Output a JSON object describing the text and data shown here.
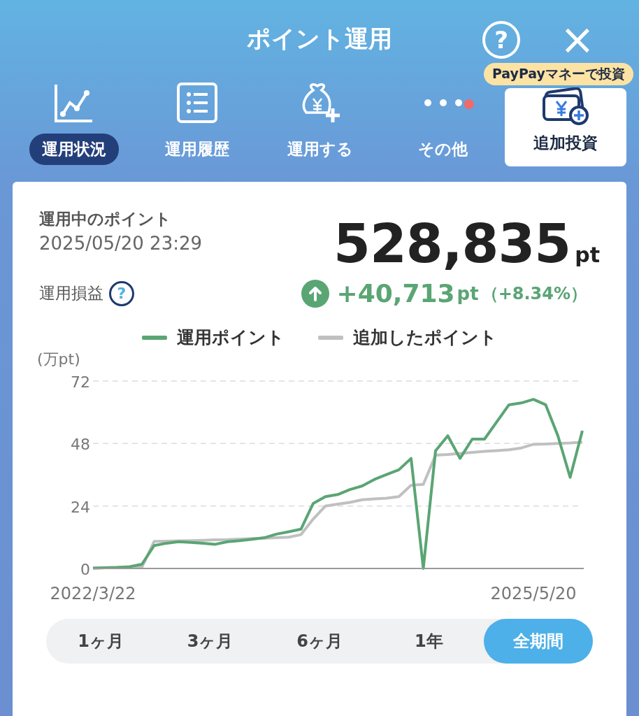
{
  "header": {
    "title": "ポイント運用",
    "help_icon": "?",
    "close_icon": "×"
  },
  "tabs": [
    {
      "label": "運用状況",
      "selected": true,
      "kind": "normal"
    },
    {
      "label": "運用履歴",
      "selected": false,
      "kind": "normal"
    },
    {
      "label": "運用する",
      "selected": false,
      "kind": "normal"
    },
    {
      "label": "その他",
      "selected": false,
      "kind": "normal",
      "notification_dot": true
    },
    {
      "label": "追加投資",
      "selected": false,
      "kind": "highlight",
      "badge": "PayPayマネーで投資"
    }
  ],
  "summary": {
    "label": "運用中のポイント",
    "timestamp": "2025/05/20 23:29",
    "points": "528,835",
    "points_unit": "pt",
    "profit_label": "運用損益",
    "profit_help": "?",
    "profit_value": "+40,713",
    "profit_unit": "pt",
    "profit_percent": "（+8.34%）"
  },
  "chart_data": {
    "type": "line",
    "ylabel": "(万pt)",
    "categories": [
      "2022/3/22",
      null,
      null,
      null,
      null,
      null,
      null,
      null,
      null,
      null,
      null,
      null,
      null,
      null,
      null,
      null,
      null,
      null,
      null,
      null,
      null,
      null,
      null,
      null,
      null,
      null,
      null,
      null,
      null,
      null,
      null,
      null,
      null,
      null,
      null,
      null,
      "2025/5/20",
      null,
      null,
      null,
      null
    ],
    "ylim": [
      0,
      72
    ],
    "yticks": [
      0,
      24,
      48,
      72
    ],
    "series": [
      {
        "name": "運用ポイント",
        "color": "#5aa574",
        "values": [
          0.1,
          0.3,
          0.4,
          0.7,
          1.6,
          8.8,
          9.7,
          10.3,
          10,
          9.7,
          9.3,
          10.3,
          10.7,
          11.2,
          11.8,
          13.2,
          14.1,
          15.1,
          25,
          27.6,
          28.4,
          30.3,
          31.7,
          34.2,
          36.1,
          37.9,
          42.3,
          0,
          45.2,
          51,
          42.3,
          49.7,
          49.7,
          56.3,
          62.9,
          63.6,
          65,
          62.9,
          51,
          35,
          52.9
        ]
      },
      {
        "name": "追加したポイント",
        "color": "#c0c0c0",
        "values": [
          0.1,
          0.3,
          0.4,
          0.5,
          0.5,
          10.4,
          10.5,
          10.6,
          10.7,
          10.8,
          11,
          11.1,
          11.3,
          11.5,
          11.6,
          11.8,
          12,
          13,
          19,
          24,
          24.7,
          25.4,
          26.4,
          26.7,
          27,
          27.6,
          32,
          32.3,
          43.5,
          43.8,
          44.2,
          44.6,
          45,
          45.3,
          45.6,
          46.3,
          47.7,
          47.8,
          48,
          48.2,
          48.5
        ]
      }
    ]
  },
  "periods": [
    {
      "label": "1ヶ月",
      "selected": false
    },
    {
      "label": "3ヶ月",
      "selected": false
    },
    {
      "label": "6ヶ月",
      "selected": false
    },
    {
      "label": "1年",
      "selected": false
    },
    {
      "label": "全期間",
      "selected": true
    }
  ]
}
